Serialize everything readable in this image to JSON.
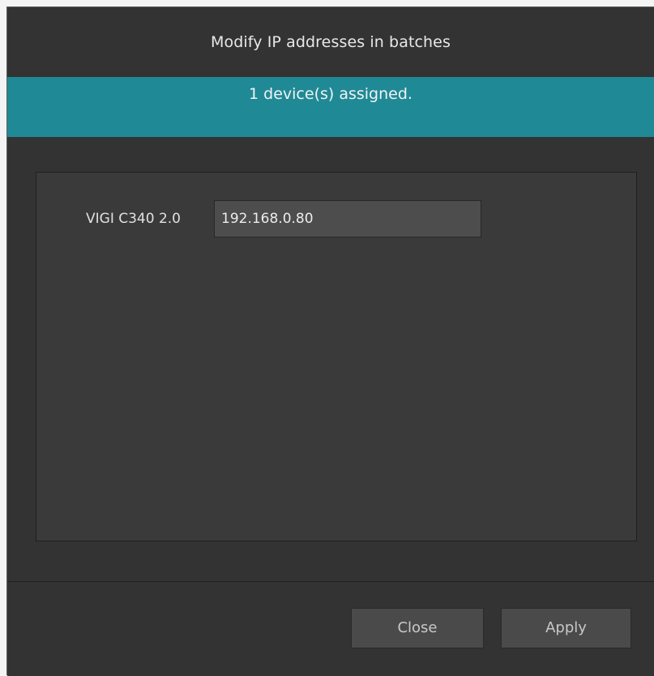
{
  "dialog": {
    "title": "Modify IP addresses in batches",
    "banner_text": "1 device(s) assigned."
  },
  "devices": [
    {
      "name": "VIGI C340 2.0",
      "ip": "192.168.0.80"
    }
  ],
  "footer": {
    "close_label": "Close",
    "apply_label": "Apply"
  },
  "colors": {
    "background": "#333333",
    "banner": "#1f8a96",
    "input": "#4d4d4d",
    "button": "#4a4a4a"
  }
}
